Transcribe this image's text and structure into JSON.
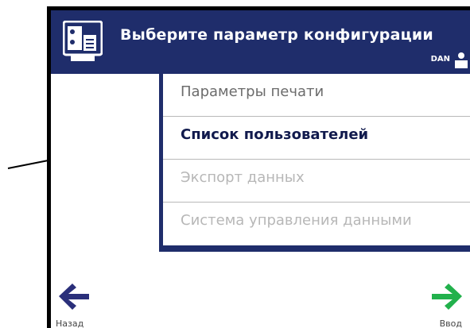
{
  "header": {
    "title": "Выберите параметр конфигурации",
    "user": "DAN",
    "icon": "settings-card-icon",
    "user_icon": "user-icon"
  },
  "menu": {
    "items": [
      {
        "label": "Параметры печати",
        "state": "normal"
      },
      {
        "label": "Список пользователей",
        "state": "highlighted"
      },
      {
        "label": "Экспорт данных",
        "state": "disabled"
      },
      {
        "label": "Система управления данными",
        "state": "disabled"
      }
    ]
  },
  "footer": {
    "back_label": "Назад",
    "enter_label": "Ввод",
    "back_icon": "arrow-left-icon",
    "enter_icon": "arrow-right-icon"
  },
  "colors": {
    "header_bg": "#1f2d6b",
    "back_arrow": "#2a2f7a",
    "enter_arrow": "#22b14c",
    "highlight_text": "#111a4d",
    "disabled_text": "#b7b7b7"
  }
}
